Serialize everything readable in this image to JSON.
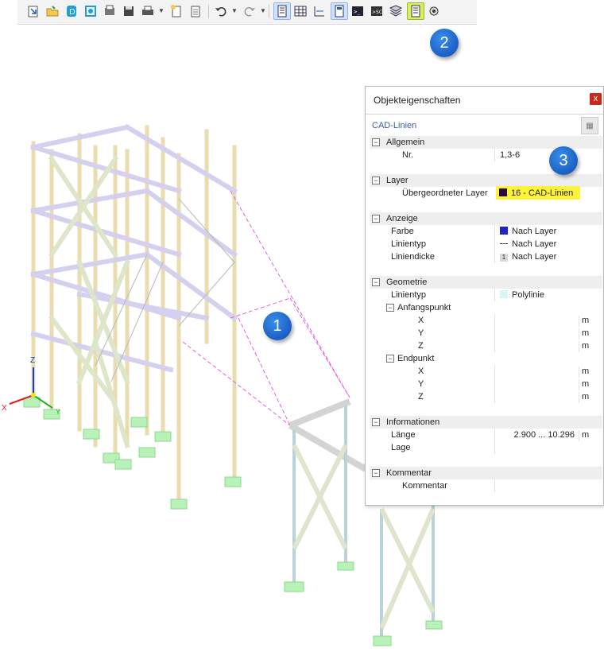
{
  "toolbar": {
    "buttons": [
      "import-icon",
      "open-icon",
      "dlubal-icon",
      "webservice-icon",
      "print-report-icon",
      "save-icon",
      "print-icon",
      "new-page-icon",
      "page-icon",
      "undo-icon",
      "redo-icon",
      "panel-navigator-icon",
      "table-icon",
      "dimension-icon",
      "panel-icon",
      "console-icon",
      "script-icon",
      "layers-icon",
      "properties-icon",
      "view-icon"
    ]
  },
  "badges": [
    "1",
    "2",
    "3"
  ],
  "panel": {
    "title": "Objekteigenschaften",
    "close": "x",
    "subtitle": "CAD-Linien",
    "sections": {
      "allgemein": {
        "label": "Allgemein",
        "nr_label": "Nr.",
        "nr_value": "1,3-6"
      },
      "layer": {
        "label": "Layer",
        "parent_label": "Übergeordneter Layer",
        "parent_value": "16 - CAD-Linien",
        "parent_color": "#2a0a3a"
      },
      "anzeige": {
        "label": "Anzeige",
        "farbe_label": "Farbe",
        "farbe_value": "Nach Layer",
        "farbe_color": "#2222cc",
        "linientyp_label": "Linientyp",
        "linientyp_value": "Nach Layer",
        "liniendicke_label": "Liniendicke",
        "liniendicke_num": "1",
        "liniendicke_value": "Nach Layer"
      },
      "geometrie": {
        "label": "Geometrie",
        "linientyp_label": "Linientyp",
        "linientyp_value": "Polylinie",
        "anfangspunkt": "Anfangspunkt",
        "endpunkt": "Endpunkt",
        "x": "X",
        "y": "Y",
        "z": "Z",
        "unit": "m"
      },
      "informationen": {
        "label": "Informationen",
        "laenge_label": "Länge",
        "laenge_value": "2.900 ... 10.296",
        "laenge_unit": "m",
        "lage_label": "Lage"
      },
      "kommentar": {
        "label": "Kommentar",
        "kommentar_label": "Kommentar"
      }
    }
  },
  "axes": {
    "x": "X",
    "y": "Y",
    "z": "Z"
  },
  "colors": {
    "accent": "#1a5fc4",
    "highlight": "#fff23a",
    "cad_line": "#e060e0"
  }
}
